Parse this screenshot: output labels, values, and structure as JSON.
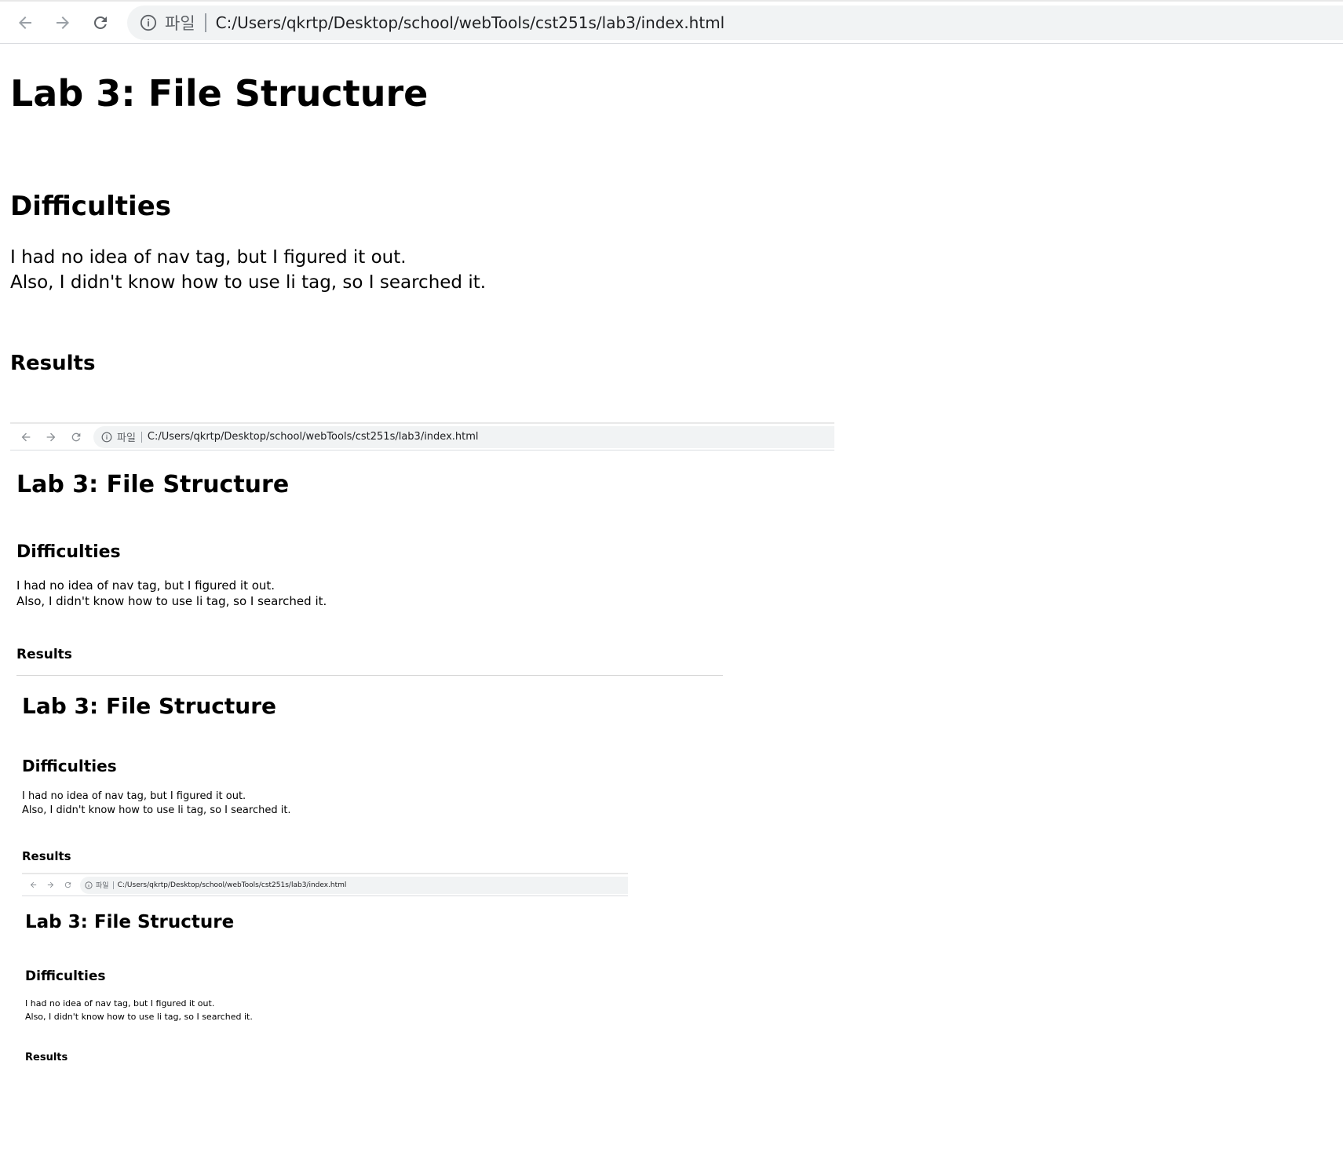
{
  "browser": {
    "scheme_label": "파일",
    "url": "C:/Users/qkrtp/Desktop/school/webTools/cst251s/lab3/index.html"
  },
  "page": {
    "title": "Lab 3: File Structure",
    "difficulties_heading": "Difficulties",
    "difficulties_line1": "I had no idea of nav tag, but I figured it out.",
    "difficulties_line2": "Also, I didn't know how to use li tag, so I searched it.",
    "results_heading": "Results"
  }
}
